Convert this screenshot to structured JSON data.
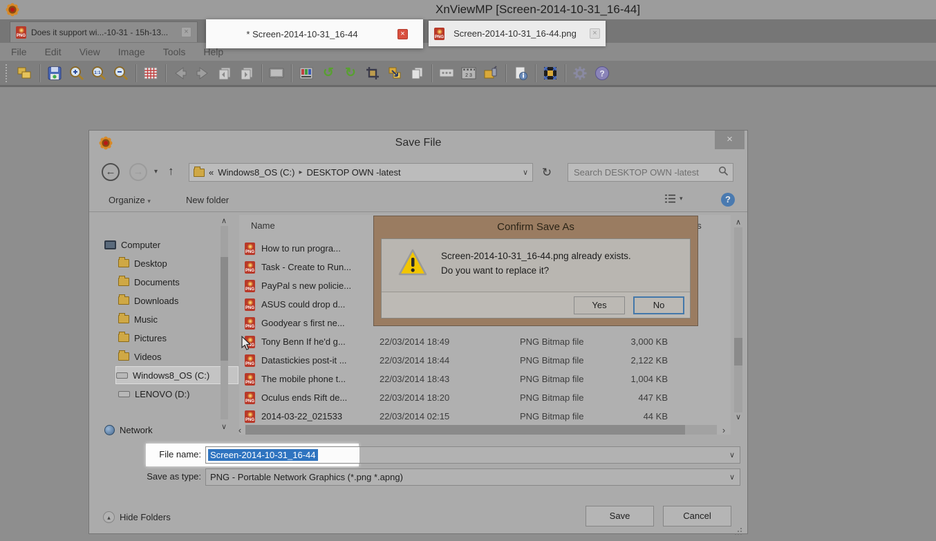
{
  "window": {
    "title": "XnViewMP [Screen-2014-10-31_16-44]",
    "tabs": [
      {
        "label": "Does it support wi...-10-31 - 15h-13..."
      },
      {
        "label": "* Screen-2014-10-31_16-44"
      },
      {
        "label": "Screen-2014-10-31_16-44.png"
      }
    ],
    "menu": [
      "File",
      "Edit",
      "View",
      "Image",
      "Tools",
      "Help"
    ]
  },
  "toolbar": {
    "icon_names": [
      "browse-folders",
      "save",
      "zoom-in",
      "zoom-actual",
      "zoom-out",
      "thumbnails-grid",
      "previous",
      "next",
      "previous-image",
      "next-image",
      "slideshow",
      "adjust-colors",
      "rotate-left",
      "rotate-right",
      "crop",
      "resize",
      "copy",
      "captions",
      "filmstrip",
      "edit-image",
      "info",
      "fullscreen",
      "settings",
      "help"
    ]
  },
  "icons": {
    "png_badge": "PNG",
    "close": "×",
    "back": "←",
    "forward": "→",
    "up": "↑",
    "refresh": "↻",
    "chevron_down": "▾",
    "caret_down": "∨",
    "scroll_up": "∧",
    "scroll_down": "∨",
    "scroll_left": "‹",
    "scroll_right": "›",
    "rotate_left": "↺",
    "rotate_right": "↻",
    "zoom_ratio": "1:1",
    "film_numbers": "2 3",
    "help": "?",
    "hide_up": "▴"
  },
  "save_dialog": {
    "title": "Save File",
    "nav": {
      "crumb_prefix": "«",
      "crumb_drive": "Windows8_OS (C:)",
      "crumb_sep": "▸",
      "crumb_folder": "DESKTOP OWN -latest",
      "search_placeholder": "Search DESKTOP OWN -latest"
    },
    "commands": {
      "organize": "Organize",
      "new_folder": "New folder"
    },
    "sidebar": [
      {
        "label": "Computer",
        "icon": "computer"
      },
      {
        "label": "Desktop",
        "icon": "folder"
      },
      {
        "label": "Documents",
        "icon": "folder"
      },
      {
        "label": "Downloads",
        "icon": "folder"
      },
      {
        "label": "Music",
        "icon": "folder"
      },
      {
        "label": "Pictures",
        "icon": "folder"
      },
      {
        "label": "Videos",
        "icon": "folder"
      },
      {
        "label": "Windows8_OS (C:)",
        "icon": "drive",
        "selected": true
      },
      {
        "label": "LENOVO (D:)",
        "icon": "drive"
      },
      {
        "label": "Network",
        "icon": "network"
      }
    ],
    "list": {
      "header_name": "Name",
      "header_tags_partial": "gs",
      "rows": [
        {
          "name": "How to run progra...",
          "date": "",
          "type": "",
          "size": ""
        },
        {
          "name": "Task - Create to Run...",
          "date": "",
          "type": "",
          "size": ""
        },
        {
          "name": "PayPal s new policie...",
          "date": "",
          "type": "",
          "size": ""
        },
        {
          "name": "ASUS could drop d...",
          "date": "",
          "type": "",
          "size": ""
        },
        {
          "name": "Goodyear s first ne...",
          "date": "",
          "type": "",
          "size": ""
        },
        {
          "name": "Tony Benn If he'd g...",
          "date": "22/03/2014 18:49",
          "type": "PNG Bitmap file",
          "size": "3,000 KB"
        },
        {
          "name": "Datastickies post-it ...",
          "date": "22/03/2014 18:44",
          "type": "PNG Bitmap file",
          "size": "2,122 KB"
        },
        {
          "name": "The mobile phone t...",
          "date": "22/03/2014 18:43",
          "type": "PNG Bitmap file",
          "size": "1,004 KB"
        },
        {
          "name": "Oculus ends Rift de...",
          "date": "22/03/2014 18:20",
          "type": "PNG Bitmap file",
          "size": "447 KB"
        },
        {
          "name": "2014-03-22_021533",
          "date": "22/03/2014 02:15",
          "type": "PNG Bitmap file",
          "size": "44 KB"
        }
      ]
    },
    "file_name_label": "File name:",
    "file_name_value": "Screen-2014-10-31_16-44",
    "save_as_type_label": "Save as type:",
    "save_as_type_value": "PNG - Portable Network Graphics (*.png *.apng)",
    "hide_folders_label": "Hide Folders",
    "save_label": "Save",
    "cancel_label": "Cancel"
  },
  "confirm_dialog": {
    "title": "Confirm Save As",
    "message_line1": "Screen-2014-10-31_16-44.png already exists.",
    "message_line2": "Do you want to replace it?",
    "yes_label": "Yes",
    "no_label": "No"
  },
  "colors": {
    "selection_blue": "#2f74c0",
    "confirm_frame_brown": "#9a7c61",
    "tab_close_red": "#d9503f",
    "warning_yellow": "#f2c500"
  }
}
